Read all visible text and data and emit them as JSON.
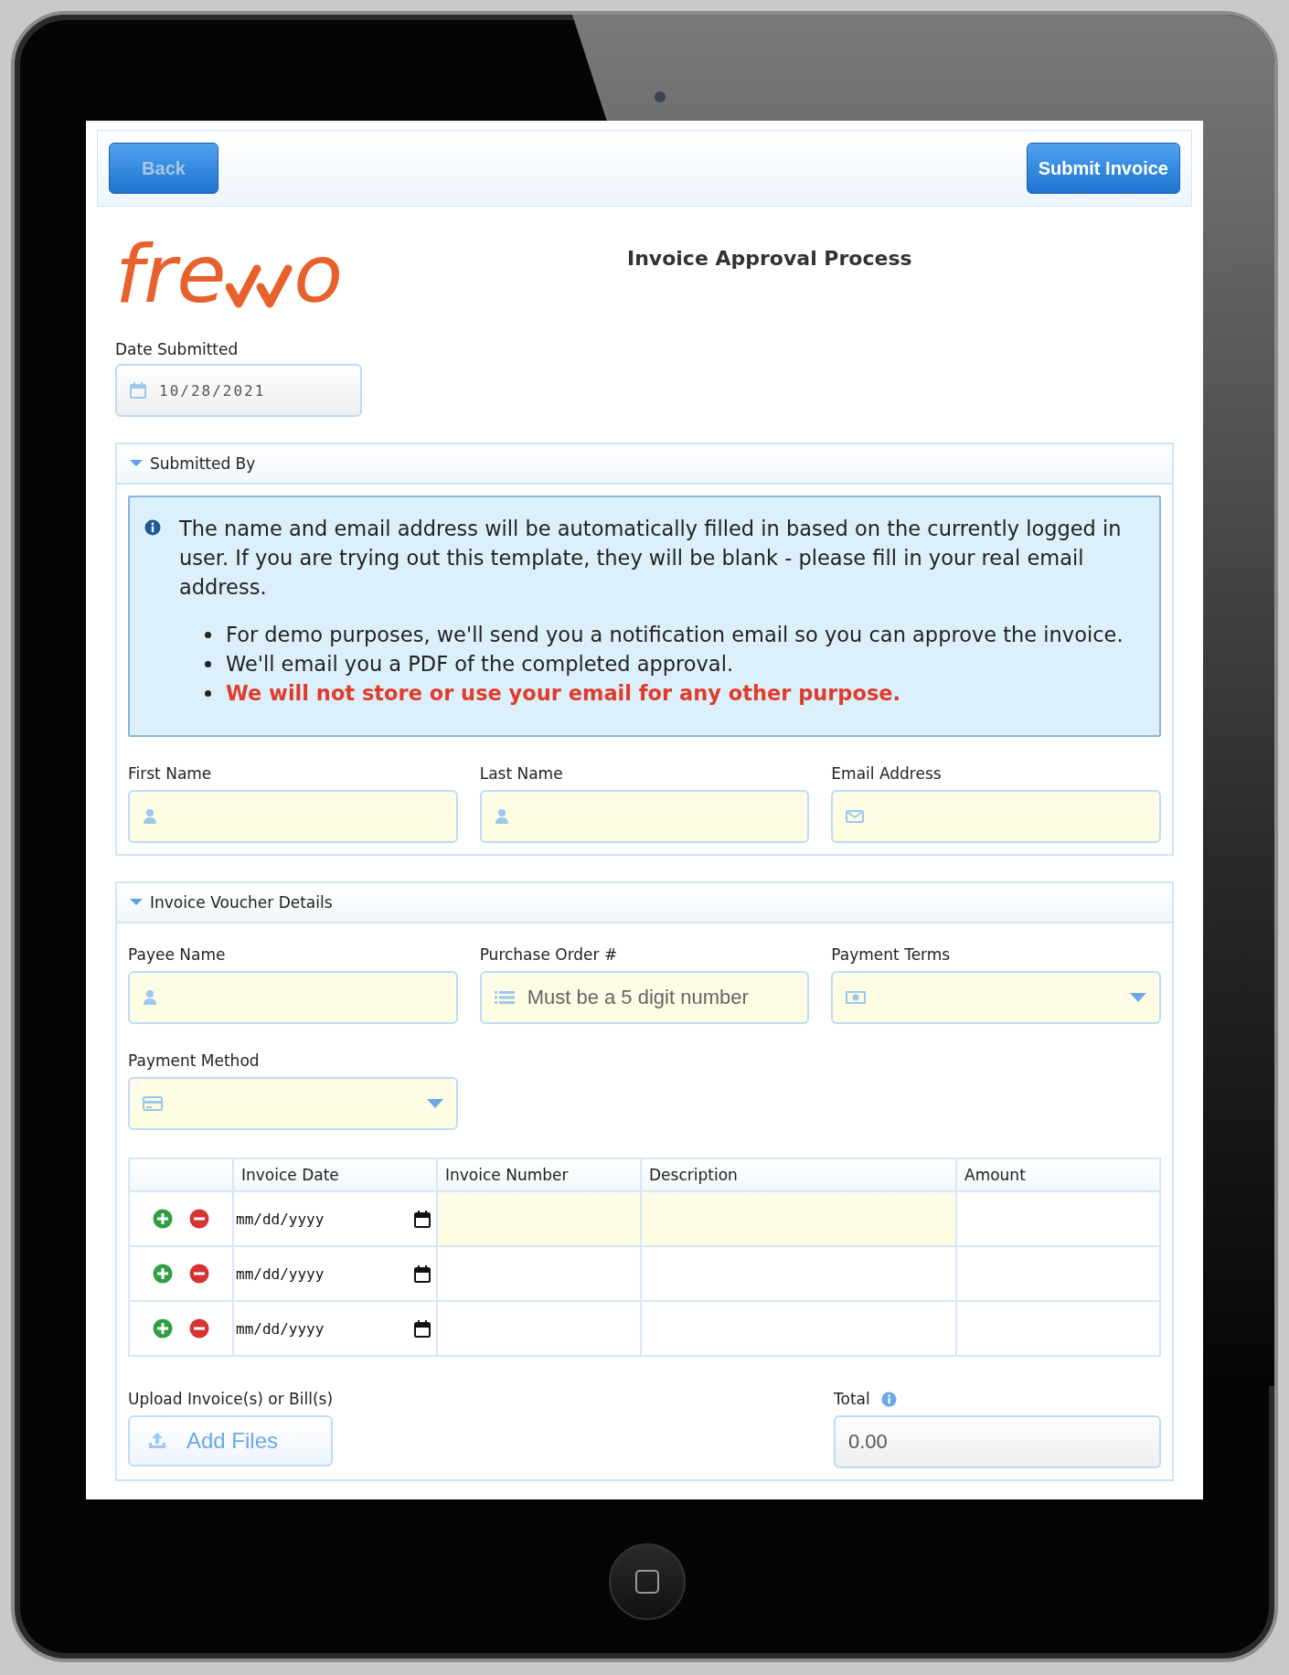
{
  "toolbar": {
    "back": {
      "label": "Back",
      "disabled": true
    },
    "submit": {
      "label": "Submit Invoice",
      "disabled": false
    }
  },
  "logo": {
    "before": "fre",
    "after": "o"
  },
  "title": "Invoice Approval Process",
  "date_submitted": {
    "label": "Date Submitted",
    "value": "10/28/2021"
  },
  "submitted_by": {
    "title": "Submitted By",
    "expanded": true,
    "info": {
      "paragraph": "The name and email address will be automatically filled in based on the currently logged in user. If you are trying out this template, they will be blank - please fill in your real email address.",
      "bullets": [
        {
          "text": "For demo purposes, we'll send you a notification email so you can approve the invoice.",
          "emphasis": false
        },
        {
          "text": "We'll email you a PDF of the completed approval.",
          "emphasis": false
        },
        {
          "text": "We will not store or use your email for any other purpose.",
          "emphasis": true
        }
      ]
    },
    "fields": [
      {
        "label": "First Name",
        "kind": "person"
      },
      {
        "label": "Last Name",
        "kind": "person"
      },
      {
        "label": "Email Address",
        "kind": "email"
      }
    ]
  },
  "voucher": {
    "title": "Invoice Voucher Details",
    "expanded": true,
    "fields": [
      {
        "label": "Payee Name",
        "kind": "person"
      },
      {
        "label": "Purchase Order #",
        "kind": "number",
        "placeholder": "Must be a 5 digit number"
      },
      {
        "label": "Payment Terms",
        "kind": "terms"
      },
      {
        "label": "Payment Method",
        "kind": "method"
      }
    ],
    "table": {
      "columns": [
        "Invoice Date",
        "Invoice Number",
        "Description",
        "Amount"
      ],
      "rows": [
        {
          "date_placeholder": "mm/dd/yyyy",
          "required": true
        },
        {
          "date_placeholder": "mm/dd/yyyy",
          "required": false
        },
        {
          "date_placeholder": "mm/dd/yyyy",
          "required": false
        }
      ]
    },
    "upload": {
      "label": "Upload Invoice(s) or Bill(s)",
      "button": "Add Files"
    },
    "total": {
      "label": "Total",
      "value": "0.00"
    }
  }
}
